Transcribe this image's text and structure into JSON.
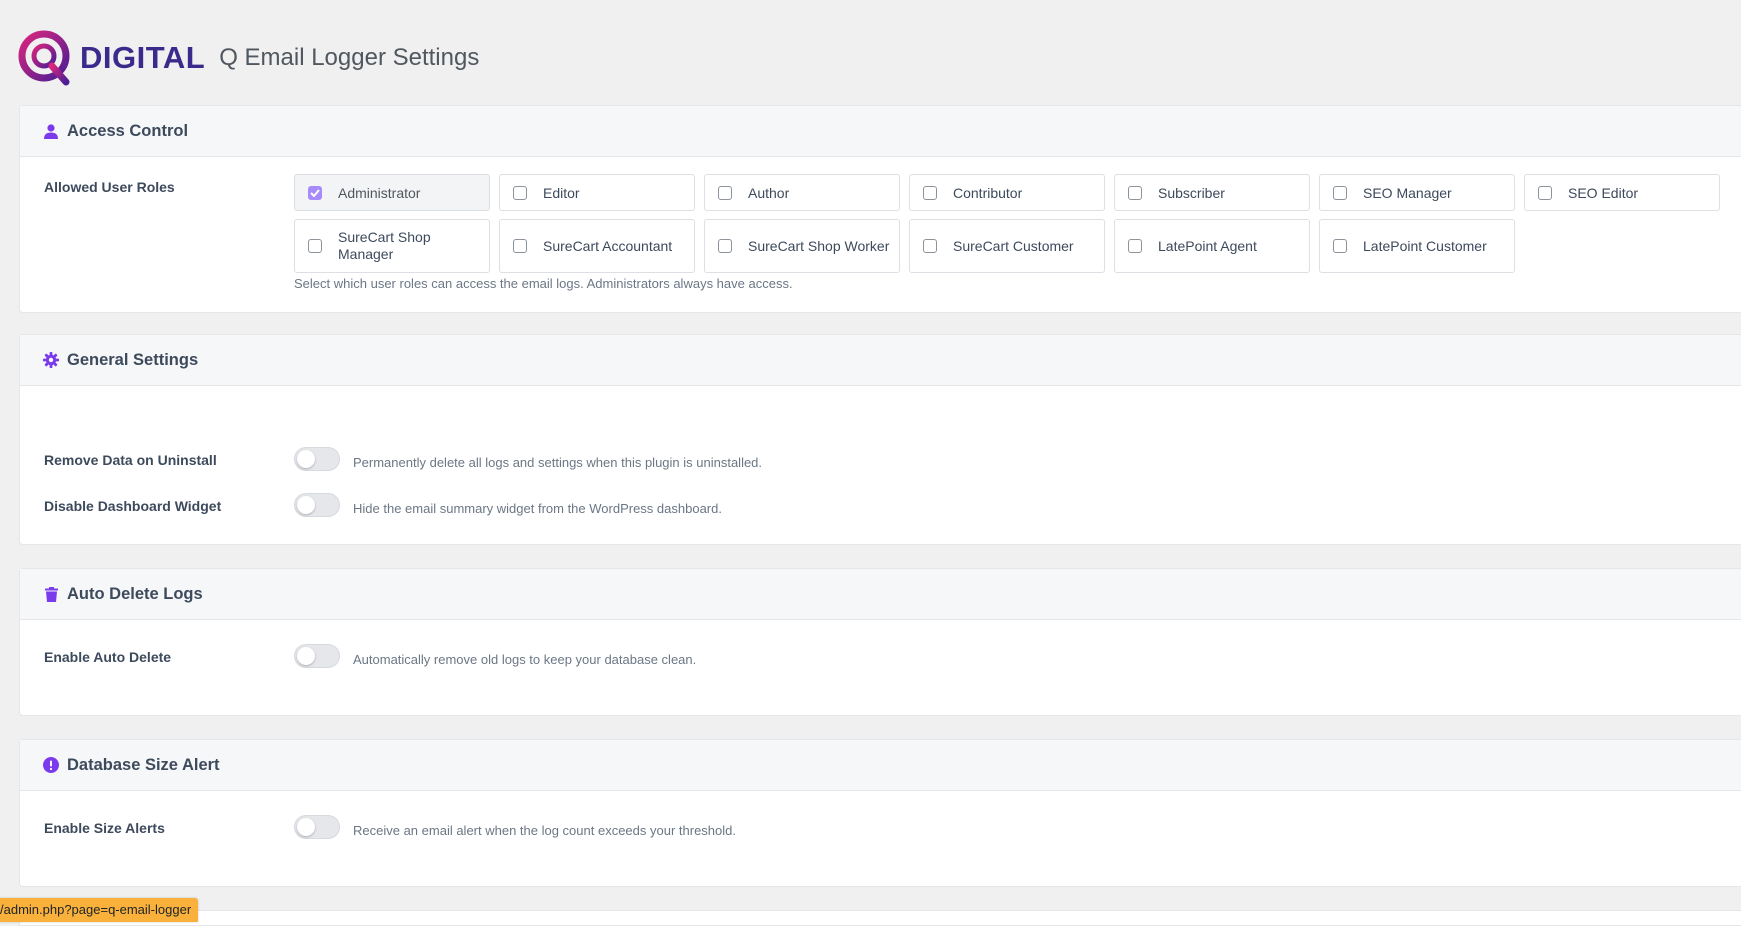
{
  "header": {
    "logo_text": "DIGITAL",
    "title": "Q Email Logger Settings"
  },
  "access_control": {
    "title": "Access Control",
    "icon": "user-icon",
    "label": "Allowed User Roles",
    "roles": [
      {
        "label": "Administrator",
        "checked": true
      },
      {
        "label": "Editor",
        "checked": false
      },
      {
        "label": "Author",
        "checked": false
      },
      {
        "label": "Contributor",
        "checked": false
      },
      {
        "label": "Subscriber",
        "checked": false
      },
      {
        "label": "SEO Manager",
        "checked": false
      },
      {
        "label": "SEO Editor",
        "checked": false
      },
      {
        "label": "SureCart Shop Manager",
        "checked": false
      },
      {
        "label": "SureCart Accountant",
        "checked": false
      },
      {
        "label": "SureCart Shop Worker",
        "checked": false
      },
      {
        "label": "SureCart Customer",
        "checked": false
      },
      {
        "label": "LatePoint Agent",
        "checked": false
      },
      {
        "label": "LatePoint Customer",
        "checked": false
      }
    ],
    "help": "Select which user roles can access the email logs. Administrators always have access."
  },
  "general_settings": {
    "title": "General Settings",
    "icon": "gear-icon",
    "rows": [
      {
        "label": "Remove Data on Uninstall",
        "help": "Permanently delete all logs and settings when this plugin is uninstalled.",
        "enabled": false
      },
      {
        "label": "Disable Dashboard Widget",
        "help": "Hide the email summary widget from the WordPress dashboard.",
        "enabled": false
      }
    ]
  },
  "auto_delete": {
    "title": "Auto Delete Logs",
    "icon": "trash-icon",
    "label": "Enable Auto Delete",
    "help": "Automatically remove old logs to keep your database clean.",
    "enabled": false
  },
  "db_alert": {
    "title": "Database Size Alert",
    "icon": "alert-circle-icon",
    "label": "Enable Size Alerts",
    "help": "Receive an email alert when the log count exceeds your threshold.",
    "enabled": false
  },
  "status_url": "/admin.php?page=q-email-logger",
  "colors": {
    "accent": "#7c3aed",
    "logo_gradient_start": "#c026d3",
    "logo_gradient_end": "#4c1d95"
  }
}
